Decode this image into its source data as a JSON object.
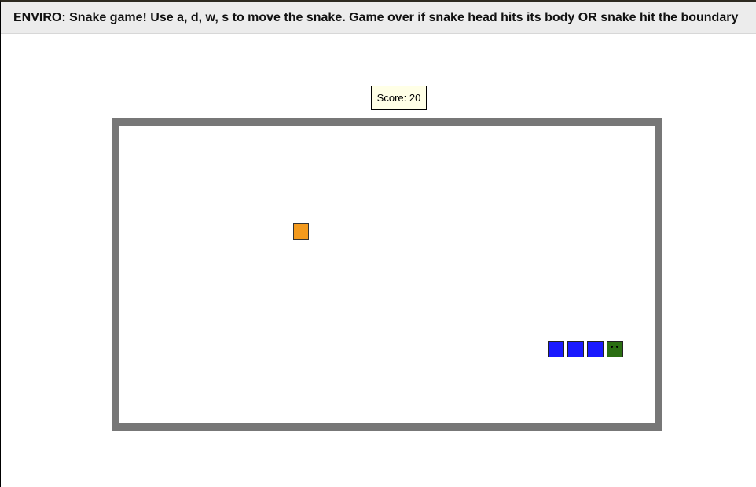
{
  "instructions": "ENVIRO: Snake game! Use a, d, w, s to move the snake. Game over if snake head hits its body OR snake hit the boundary",
  "score": {
    "text": "Score: 20",
    "value": 20
  },
  "colors": {
    "boundary": "#777777",
    "food": "#f39a1d",
    "snake_body": "#1a1aff",
    "snake_head": "#2a6e12",
    "score_bg": "#ffffe6"
  },
  "game": {
    "food": {
      "col": 10,
      "row": 5
    },
    "snake": {
      "direction": "right",
      "head": {
        "col": 26,
        "row": 11
      },
      "body": [
        {
          "col": 25,
          "row": 11
        },
        {
          "col": 24,
          "row": 11
        },
        {
          "col": 23,
          "row": 11
        }
      ]
    }
  }
}
